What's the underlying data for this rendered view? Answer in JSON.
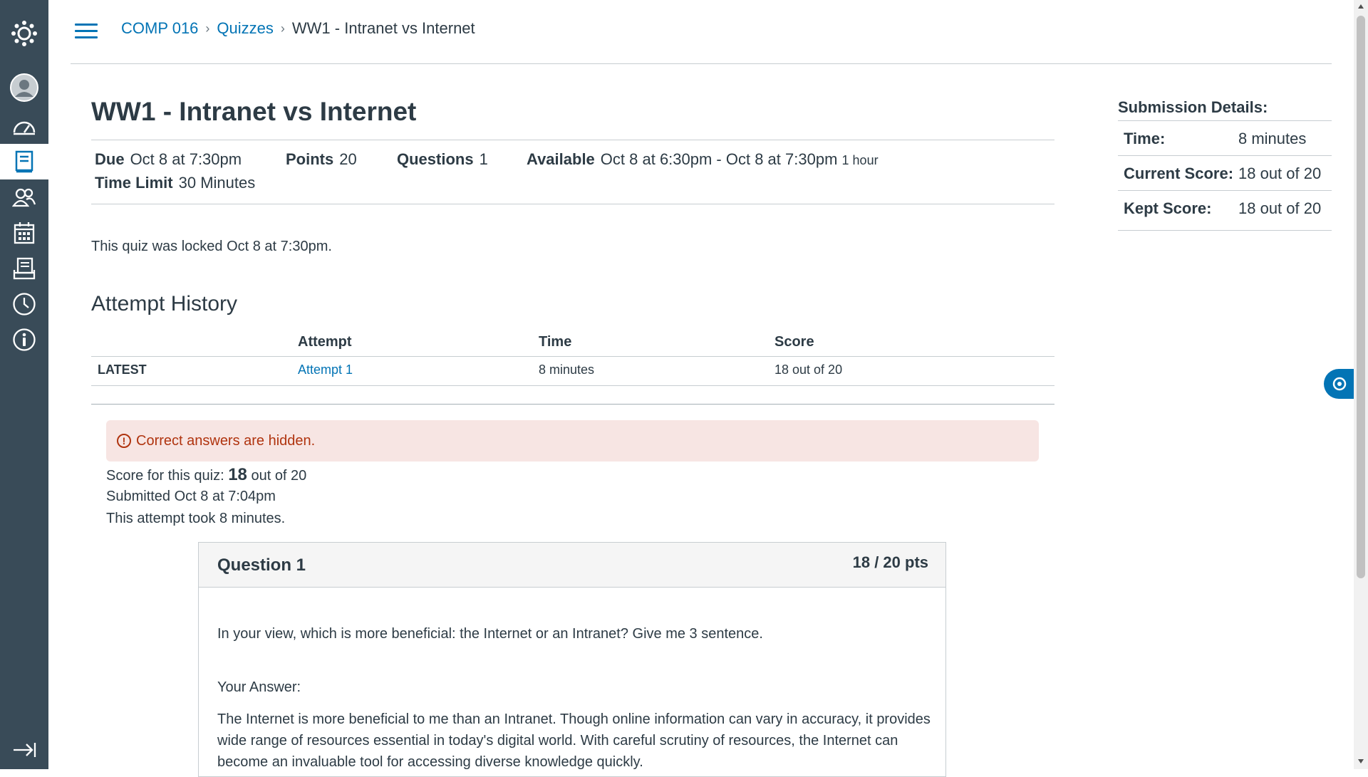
{
  "nav": {
    "items": [
      "logo-icon",
      "account-icon",
      "dashboard-icon",
      "courses-icon",
      "groups-icon",
      "calendar-icon",
      "inbox-icon",
      "history-icon",
      "help-icon"
    ],
    "active": "courses-icon"
  },
  "breadcrumb": {
    "course": "COMP 016",
    "section": "Quizzes",
    "current": "WW1 - Intranet vs Internet"
  },
  "quiz": {
    "title": "WW1 - Intranet vs Internet",
    "due_label": "Due",
    "due_value": "Oct 8 at 7:30pm",
    "points_label": "Points",
    "points_value": "20",
    "questions_label": "Questions",
    "questions_value": "1",
    "available_label": "Available",
    "available_value": "Oct 8 at 6:30pm - Oct 8 at 7:30pm",
    "available_duration": "1 hour",
    "time_limit_label": "Time Limit",
    "time_limit_value": "30 Minutes",
    "locked_message": "This quiz was locked Oct 8 at 7:30pm."
  },
  "attempt_history": {
    "heading": "Attempt History",
    "columns": [
      "Attempt",
      "Time",
      "Score"
    ],
    "rows": [
      {
        "tag": "LATEST",
        "attempt": "Attempt 1",
        "time": "8 minutes",
        "score": "18 out of 20"
      }
    ]
  },
  "results": {
    "alert": "Correct answers are hidden.",
    "score_prefix": "Score for this quiz:",
    "score_value": "18",
    "score_suffix": "out of 20",
    "submitted": "Submitted Oct 8 at 7:04pm",
    "duration": "This attempt took 8 minutes."
  },
  "question": {
    "title": "Question 1",
    "points": "18 / 20 pts",
    "prompt": "In your view, which is more beneficial: the Internet or an Intranet? Give me 3 sentence.",
    "answer_label": "Your Answer:",
    "answer_lines": [
      "The Internet is more beneficial to me than an Intranet. Though online information can vary in accuracy, it provides",
      "wide range of resources essential in today's digital world. With careful scrutiny of resources, the Internet can",
      "become an invaluable tool for accessing diverse knowledge quickly."
    ]
  },
  "submission_details": {
    "heading": "Submission Details:",
    "rows": [
      {
        "label": "Time:",
        "value": "8 minutes"
      },
      {
        "label": "Current Score:",
        "value": "18 out of 20"
      },
      {
        "label": "Kept Score:",
        "value": "18 out of 20"
      }
    ]
  },
  "colors": {
    "nav_bg": "#394b58",
    "link": "#0374b5",
    "alert_bg": "#f7e5e3",
    "alert_text": "#b0340f"
  }
}
